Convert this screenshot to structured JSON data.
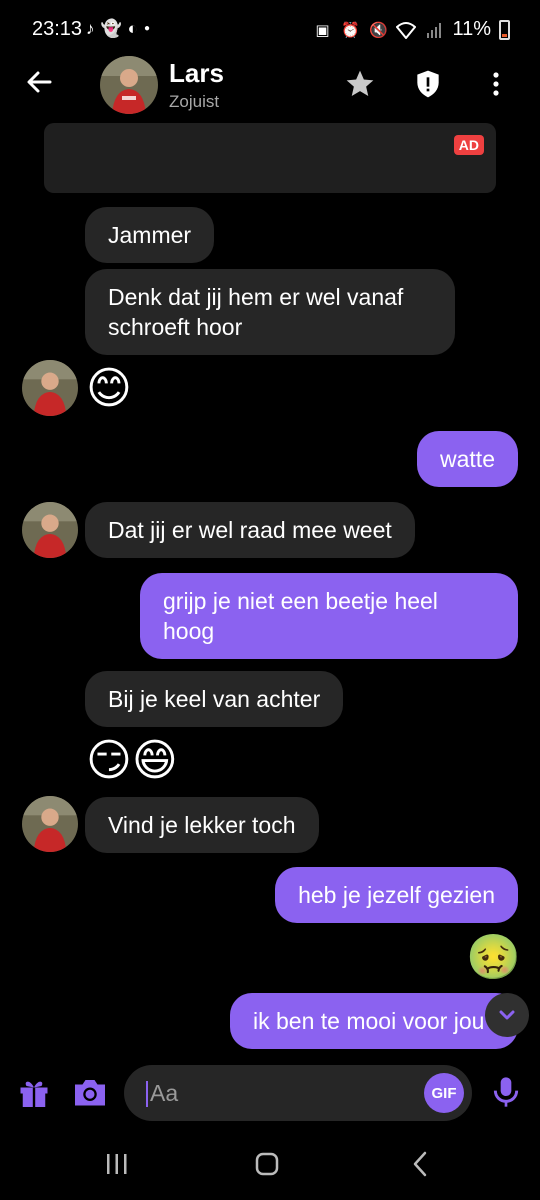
{
  "status_bar": {
    "time": "23:13",
    "battery": "11%",
    "left_icons": [
      "tiktok-icon",
      "snapchat-icon",
      "app-icon",
      "dot-icon"
    ],
    "right_icons": [
      "battery-saver-icon",
      "alarm-icon",
      "mute-icon",
      "wifi-icon",
      "signal-icon"
    ]
  },
  "header": {
    "contact_name": "Lars",
    "contact_status": "Zojuist",
    "icons": [
      "back-arrow-icon",
      "star-icon",
      "shield-alert-icon",
      "more-vertical-icon"
    ]
  },
  "ad": {
    "badge": "AD"
  },
  "messages": [
    {
      "side": "in",
      "text": "Jammer"
    },
    {
      "side": "in",
      "text": "Denk dat jij hem er wel vanaf schroeft hoor"
    },
    {
      "side": "in",
      "emoji": "😊"
    },
    {
      "side": "out",
      "text": "watte"
    },
    {
      "side": "in",
      "text": "Dat jij er wel raad mee weet"
    },
    {
      "side": "out",
      "text": "grijp je niet een beetje heel hoog"
    },
    {
      "side": "in",
      "text": "Bij je keel van achter"
    },
    {
      "side": "in",
      "emoji": "😏😄"
    },
    {
      "side": "in",
      "text": "Vind je lekker toch"
    },
    {
      "side": "out",
      "text": "heb je jezelf gezien"
    },
    {
      "side": "out",
      "emoji": "🤢"
    },
    {
      "side": "out",
      "text": "ik ben te mooi voor jou"
    }
  ],
  "composer": {
    "placeholder": "Aa",
    "gif_label": "GIF",
    "icons": [
      "gift-icon",
      "camera-icon",
      "microphone-icon"
    ]
  },
  "colors": {
    "accent": "#8b62f0",
    "incoming_bubble": "#262626",
    "background": "#000000"
  }
}
